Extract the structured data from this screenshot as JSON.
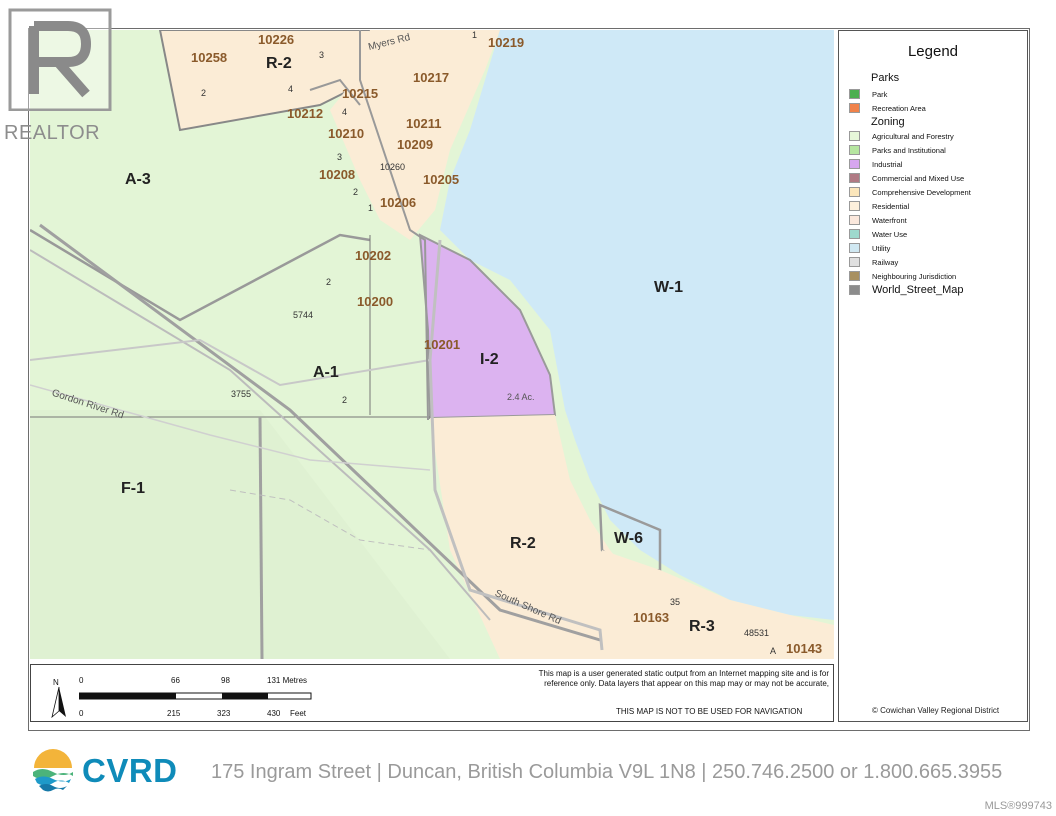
{
  "map": {
    "zones": {
      "A3": "A-3",
      "A1": "A-1",
      "F1": "F-1",
      "I2": "I-2",
      "R2_south": "R-2",
      "R2_north": "R-2",
      "W1": "W-1",
      "W6": "W-6",
      "R3": "R-3"
    },
    "addresses": [
      "10258",
      "10226",
      "10219",
      "10217",
      "10215",
      "10212",
      "10211",
      "10210",
      "10209",
      "10208",
      "10205",
      "10206",
      "10202",
      "10200",
      "10201",
      "10163",
      "10143"
    ],
    "small_labels": {
      "lot3_top": "3",
      "lot2_nw": "2",
      "lot4_a": "4",
      "lot4_b": "4",
      "lot3_b": "3",
      "lot1_top": "1",
      "lot10260": "10260",
      "lot2_c": "2",
      "lot1_c": "1",
      "lot2_d": "2",
      "lot5744": "5744",
      "lot3755": "3755",
      "lot2_e": "2",
      "acreage": "2.4 Ac.",
      "lot35": "35",
      "lot48531": "48531",
      "lotA": "A"
    },
    "roads": {
      "myers": "Myers Rd",
      "gordon_river": "Gordon River Rd",
      "south_shore": "South Shore Rd"
    }
  },
  "legend": {
    "title": "Legend",
    "groups": [
      {
        "name": "Parks",
        "items": [
          {
            "label": "Park",
            "color": "#4caf50"
          },
          {
            "label": "Recreation Area",
            "color": "#f0824a"
          }
        ]
      },
      {
        "name": "Zoning",
        "items": [
          {
            "label": "Agricultural and Forestry",
            "color": "#e6f7d9"
          },
          {
            "label": "Parks and Institutional",
            "color": "#b6e6a0"
          },
          {
            "label": "Industrial",
            "color": "#d6a6ee"
          },
          {
            "label": "Commercial and Mixed Use",
            "color": "#b07a84"
          },
          {
            "label": "Comprehensive Development",
            "color": "#fbe6bb"
          },
          {
            "label": "Residential",
            "color": "#fdf0dc"
          },
          {
            "label": "Waterfront",
            "color": "#fbe8dd"
          },
          {
            "label": "Water Use",
            "color": "#9ed9cd"
          },
          {
            "label": "Utility",
            "color": "#d0e8f2"
          },
          {
            "label": "Railway",
            "color": "#e0e0e0"
          },
          {
            "label": "Neighbouring Jurisdiction",
            "color": "#a89060"
          }
        ]
      }
    ],
    "base_layer": {
      "label": "World_Street_Map",
      "color": "#8c8c8c"
    },
    "credit": "© Cowichan Valley Regional District"
  },
  "scale": {
    "metres": [
      "0",
      "66",
      "98",
      "131 Metres"
    ],
    "feet": [
      "0",
      "215",
      "323",
      "430",
      "Feet"
    ],
    "north": "N"
  },
  "disclaimer": "This map is a user generated static output from an Internet mapping site and is for reference only. Data layers that appear on this map may or may not be accurate,",
  "nav_warning": "THIS MAP IS NOT TO BE USED FOR NAVIGATION",
  "footer": {
    "brand": "CVRD",
    "address": "175 Ingram Street | Duncan, British Columbia V9L 1N8 | 250.746.2500 or 1.800.665.3955",
    "mls": "MLS®999743",
    "realtor": "REALTOR"
  }
}
